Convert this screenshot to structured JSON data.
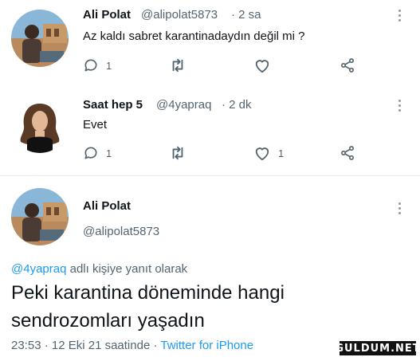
{
  "tweet1": {
    "name": "Ali Polat",
    "handle": "@alipolat5873",
    "time": "· 2 sa",
    "text": "Az kaldı sabret karantinadaydın değil mi ?",
    "reply_count": "1",
    "like_count": ""
  },
  "tweet2": {
    "name": "Saat hep 5",
    "handle": "@4yapraq",
    "time": "· 2 dk",
    "text": "Evet",
    "reply_count": "1",
    "like_count": "1"
  },
  "main_tweet": {
    "name": "Ali Polat",
    "handle": "@alipolat5873",
    "reply_to_handle": "@4yapraq",
    "reply_to_suffix": " adlı kişiye yanıt olarak",
    "text_line1": "Peki karantina döneminde hangi",
    "text_line2": "sendrozomları yaşadın",
    "timestamp": "23:53 · 12 Eki 21 saatinde ·",
    "source": "Twitter for iPhone"
  },
  "watermark": "GULDUM.NET",
  "colors": {
    "link": "#1d9bf0",
    "secondary_text": "#536471",
    "primary_text": "#0f1419"
  }
}
